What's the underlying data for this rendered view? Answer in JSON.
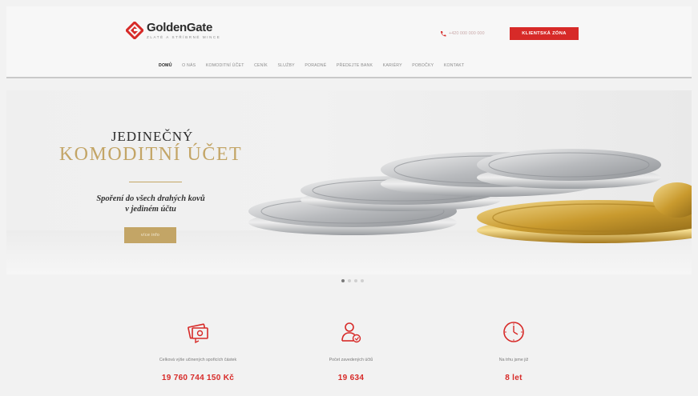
{
  "header": {
    "logo_name": "GoldenGate",
    "logo_sub": "Zlaté a stříbrné mince",
    "phone": "+420 000 000 000",
    "client_zone": "KLIENTSKÁ ZÓNA",
    "nav": [
      "DOMŮ",
      "O NÁS",
      "KOMODITNÍ ÚČET",
      "CENÍK",
      "SLUŽBY",
      "PORADNÉ",
      "PŘEDEJTE BANK",
      "KARIÉRY",
      "POBOČKY",
      "KONTAKT"
    ]
  },
  "hero": {
    "title_line1": "JEDINEČNÝ",
    "title_line2": "KOMODITNÍ ÚČET",
    "subtitle_line1": "Spoření do všech drahých kovů",
    "subtitle_line2": "v jediném účtu",
    "button": "více info"
  },
  "stats": [
    {
      "label": "Celková výše učinených spořicích částek",
      "value": "19 760 744 150 Kč",
      "icon": "money-icon"
    },
    {
      "label": "Počet zavedených účtů",
      "value": "19 634",
      "icon": "user-icon"
    },
    {
      "label": "Na trhu jsme již",
      "value": "8 let",
      "icon": "clock-icon"
    }
  ],
  "colors": {
    "brand_red": "#d72a28",
    "gold": "#c3a566"
  }
}
